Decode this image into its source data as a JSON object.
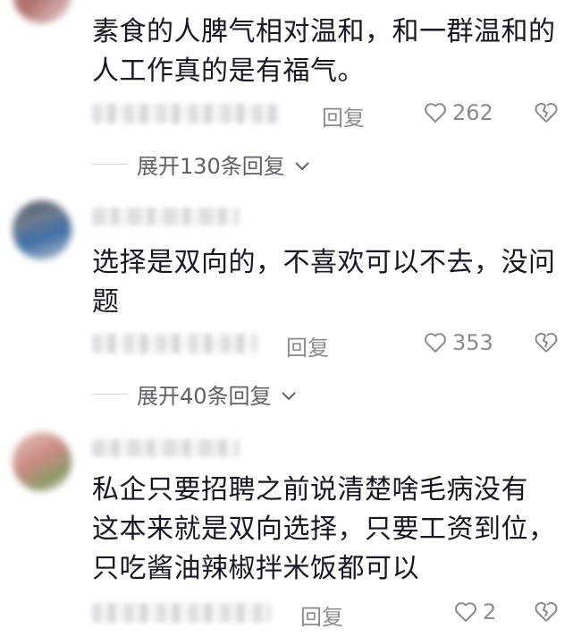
{
  "comments": [
    {
      "lines": [
        "素食的人脾气相对温和，和一群温和的",
        "人工作真的是有福气。"
      ],
      "reply_label": "回复",
      "likes": "262",
      "expand_label": "展开130条回复"
    },
    {
      "lines": [
        "选择是双向的，不喜欢可以不去，没问",
        "题"
      ],
      "reply_label": "回复",
      "likes": "353",
      "expand_label": "展开40条回复"
    },
    {
      "lines": [
        "私企只要招聘之前说清楚啥毛病没有",
        "这本来就是双向选择，只要工资到位，",
        "只吃酱油辣椒拌米饭都可以"
      ],
      "reply_label": "回复",
      "likes": "2"
    }
  ],
  "colors": {
    "text": "#161823",
    "muted": "#8a8b91",
    "line": "#cfd0d5"
  },
  "icons": {
    "like": "heart-outline-icon",
    "dislike": "broken-heart-icon",
    "expand": "chevron-down-icon"
  }
}
